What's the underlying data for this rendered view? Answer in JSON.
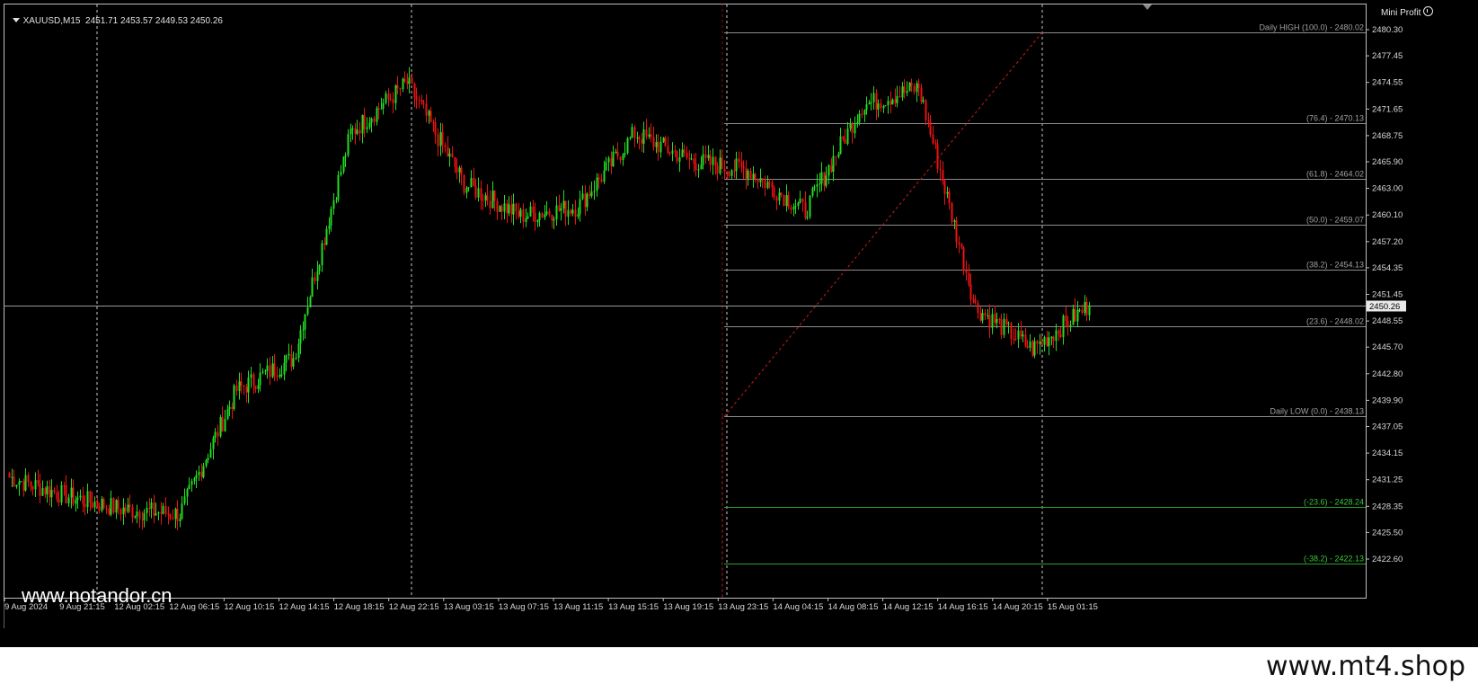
{
  "header": {
    "symbol_info": "XAUUSD,M15  2451.71 2453.57 2449.53 2450.26",
    "indicator_label": "Mini Profit"
  },
  "watermark_left": "www.notandor.cn",
  "footer_text": "www.mt4.shop",
  "price_axis": {
    "ticks": [
      "2480.30",
      "2477.45",
      "2474.55",
      "2471.65",
      "2468.75",
      "2465.90",
      "2463.00",
      "2460.10",
      "2457.20",
      "2454.35",
      "2451.45",
      "2448.55",
      "2445.70",
      "2442.80",
      "2439.90",
      "2437.05",
      "2434.15",
      "2431.25",
      "2428.35",
      "2425.50",
      "2422.60"
    ],
    "current_price": "2450.26"
  },
  "time_axis": {
    "labels": [
      "9 Aug 2024",
      "9 Aug 21:15",
      "12 Aug 02:15",
      "12 Aug 06:15",
      "12 Aug 10:15",
      "12 Aug 14:15",
      "12 Aug 18:15",
      "12 Aug 22:15",
      "13 Aug 03:15",
      "13 Aug 07:15",
      "13 Aug 11:15",
      "13 Aug 15:15",
      "13 Aug 19:15",
      "13 Aug 23:15",
      "14 Aug 04:15",
      "14 Aug 08:15",
      "14 Aug 12:15",
      "14 Aug 16:15",
      "14 Aug 20:15",
      "15 Aug 01:15"
    ]
  },
  "fib_levels": [
    {
      "label": "Daily HIGH (100.0) -  2480.02",
      "price": 2480.02,
      "color": "#a0a0a0"
    },
    {
      "label": "(76.4) -  2470.13",
      "price": 2470.13,
      "color": "#a0a0a0"
    },
    {
      "label": "(61.8) -  2464.02",
      "price": 2464.02,
      "color": "#a0a0a0"
    },
    {
      "label": "(50.0) -  2459.07",
      "price": 2459.07,
      "color": "#a0a0a0"
    },
    {
      "label": "(38.2) -  2454.13",
      "price": 2454.13,
      "color": "#a0a0a0"
    },
    {
      "label": "(23.6) -  2448.02",
      "price": 2448.02,
      "color": "#a0a0a0"
    },
    {
      "label": "Daily LOW (0.0) -  2438.13",
      "price": 2438.13,
      "color": "#a0a0a0"
    },
    {
      "label": "(-23.6) -  2428.24",
      "price": 2428.24,
      "color": "#3cc83c"
    },
    {
      "label": "(-38.2) -  2422.13",
      "price": 2422.13,
      "color": "#3cc83c"
    }
  ],
  "colors": {
    "background": "#000000",
    "bull": "#22dd22",
    "bear": "#ee1111",
    "grid": "#c8c8c8",
    "fib_line": "#8c8c8c",
    "trend_line": "#c81e1e"
  },
  "chart_data": {
    "type": "candlestick",
    "series_anchors": [
      {
        "time": "9 Aug 2024",
        "price": 2431.5
      },
      {
        "time": "9 Aug 21:15",
        "price": 2429.5
      },
      {
        "time": "12 Aug 02:15",
        "price": 2428.0
      },
      {
        "time": "12 Aug 06:15",
        "price": 2427.5
      },
      {
        "time": "12 Aug 10:15",
        "price": 2441.0
      },
      {
        "time": "12 Aug 14:15",
        "price": 2444.5
      },
      {
        "time": "12 Aug 18:15",
        "price": 2469.0
      },
      {
        "time": "12 Aug 22:15",
        "price": 2474.5
      },
      {
        "time": "13 Aug 03:15",
        "price": 2463.5
      },
      {
        "time": "13 Aug 07:15",
        "price": 2460.0
      },
      {
        "time": "13 Aug 11:15",
        "price": 2461.0
      },
      {
        "time": "13 Aug 15:15",
        "price": 2469.0
      },
      {
        "time": "13 Aug 19:15",
        "price": 2466.0
      },
      {
        "time": "13 Aug 23:15",
        "price": 2465.0
      },
      {
        "time": "14 Aug 04:15",
        "price": 2460.5
      },
      {
        "time": "14 Aug 08:15",
        "price": 2472.0
      },
      {
        "time": "14 Aug 12:15",
        "price": 2474.0
      },
      {
        "time": "14 Aug 16:15",
        "price": 2450.0
      },
      {
        "time": "14 Aug 20:15",
        "price": 2445.5
      },
      {
        "time": "15 Aug 01:15",
        "price": 2450.26
      }
    ],
    "ylim": [
      2422.6,
      2480.3
    ]
  }
}
